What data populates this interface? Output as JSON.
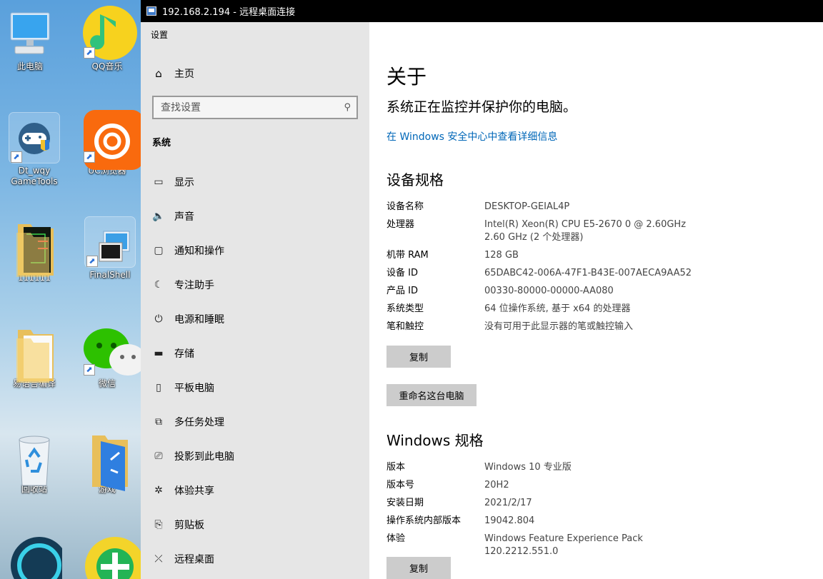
{
  "desktop": {
    "icons": [
      {
        "label": "此电脑",
        "icon": "computer-icon"
      },
      {
        "label": "QQ音乐",
        "icon": "qq-music-icon"
      },
      {
        "label": "Dt_wqy\nGameTools",
        "icon": "gamepad-icon"
      },
      {
        "label": "UC浏览器",
        "icon": "uc-browser-icon"
      },
      {
        "label": "111111",
        "icon": "folder-icon"
      },
      {
        "label": "FinalShell",
        "icon": "monitor-icon"
      },
      {
        "label": "易语言编译",
        "icon": "folder-icon"
      },
      {
        "label": "微信",
        "icon": "wechat-icon"
      },
      {
        "label": "回收站",
        "icon": "recycle-bin-icon"
      },
      {
        "label": "游戏",
        "icon": "folder-icon"
      }
    ]
  },
  "rdp": {
    "title": "192.168.2.194 - 远程桌面连接"
  },
  "settings": {
    "app_title": "设置",
    "home_label": "主页",
    "search_placeholder": "查找设置",
    "section": "系统",
    "nav": [
      {
        "label": "显示",
        "icon": "display-icon"
      },
      {
        "label": "声音",
        "icon": "speaker-icon"
      },
      {
        "label": "通知和操作",
        "icon": "notification-icon"
      },
      {
        "label": "专注助手",
        "icon": "moon-icon"
      },
      {
        "label": "电源和睡眠",
        "icon": "power-icon"
      },
      {
        "label": "存储",
        "icon": "storage-icon"
      },
      {
        "label": "平板电脑",
        "icon": "tablet-icon"
      },
      {
        "label": "多任务处理",
        "icon": "multitask-icon"
      },
      {
        "label": "投影到此电脑",
        "icon": "project-icon"
      },
      {
        "label": "体验共享",
        "icon": "share-icon"
      },
      {
        "label": "剪贴板",
        "icon": "clipboard-icon"
      },
      {
        "label": "远程桌面",
        "icon": "remote-desktop-icon"
      }
    ]
  },
  "about": {
    "title": "关于",
    "protection": "系统正在监控并保护你的电脑。",
    "security_link": "在 Windows 安全中心中查看详细信息",
    "device_title": "设备规格",
    "device_specs": [
      {
        "key": "设备名称",
        "value": "DESKTOP-GEIAL4P"
      },
      {
        "key": "处理器",
        "value": "Intel(R) Xeon(R) CPU E5-2670 0 @ 2.60GHz   2.60 GHz  (2 个处理器)"
      },
      {
        "key": "机带 RAM",
        "value": "128 GB"
      },
      {
        "key": "设备 ID",
        "value": "65DABC42-006A-47F1-B43E-007AECA9AA52"
      },
      {
        "key": "产品 ID",
        "value": "00330-80000-00000-AA080"
      },
      {
        "key": "系统类型",
        "value": "64 位操作系统, 基于 x64 的处理器"
      },
      {
        "key": "笔和触控",
        "value": "没有可用于此显示器的笔或触控输入"
      }
    ],
    "copy_label": "复制",
    "rename_label": "重命名这台电脑",
    "windows_title": "Windows 规格",
    "windows_specs": [
      {
        "key": "版本",
        "value": "Windows 10 专业版"
      },
      {
        "key": "版本号",
        "value": "20H2"
      },
      {
        "key": "安装日期",
        "value": "2021/2/17"
      },
      {
        "key": "操作系统内部版本",
        "value": "19042.804"
      },
      {
        "key": "体验",
        "value": "Windows Feature Experience Pack 120.2212.551.0"
      }
    ]
  }
}
